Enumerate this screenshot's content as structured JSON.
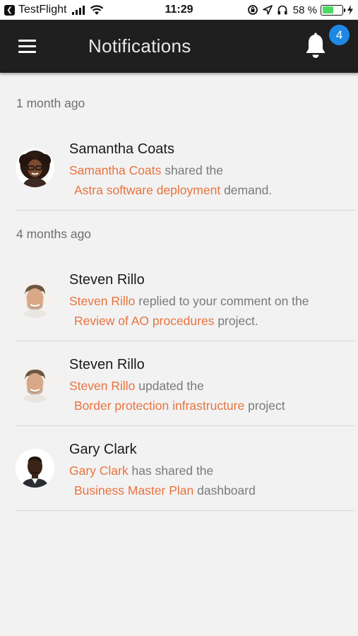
{
  "status_bar": {
    "app": "TestFlight",
    "time": "11:29",
    "battery_percent": "58 %",
    "battery_level": 0.58,
    "battery_color": "#4cd964"
  },
  "header": {
    "title": "Notifications",
    "menu_icon": "hamburger-menu-icon",
    "bell_icon": "bell-icon",
    "badge_count": "4",
    "badge_color": "#1e88e5",
    "background": "#1f1f1f"
  },
  "accent_color": "#e9733f",
  "sections": [
    {
      "label": "1 month ago",
      "items": [
        {
          "name": "Samantha Coats",
          "actor": "Samantha Coats",
          "action": "shared the",
          "target": "Astra software deployment",
          "suffix": "demand."
        }
      ]
    },
    {
      "label": "4 months ago",
      "items": [
        {
          "name": "Steven Rillo",
          "actor": "Steven Rillo",
          "action": "replied to your comment on the",
          "target": "Review of AO procedures",
          "suffix": "project."
        },
        {
          "name": "Steven Rillo",
          "actor": "Steven Rillo",
          "action": "updated the",
          "target": "Border protection infrastructure",
          "suffix": "project"
        },
        {
          "name": "Gary Clark",
          "actor": "Gary Clark",
          "action": "has shared the",
          "target": "Business Master Plan",
          "suffix": "dashboard"
        }
      ]
    }
  ]
}
